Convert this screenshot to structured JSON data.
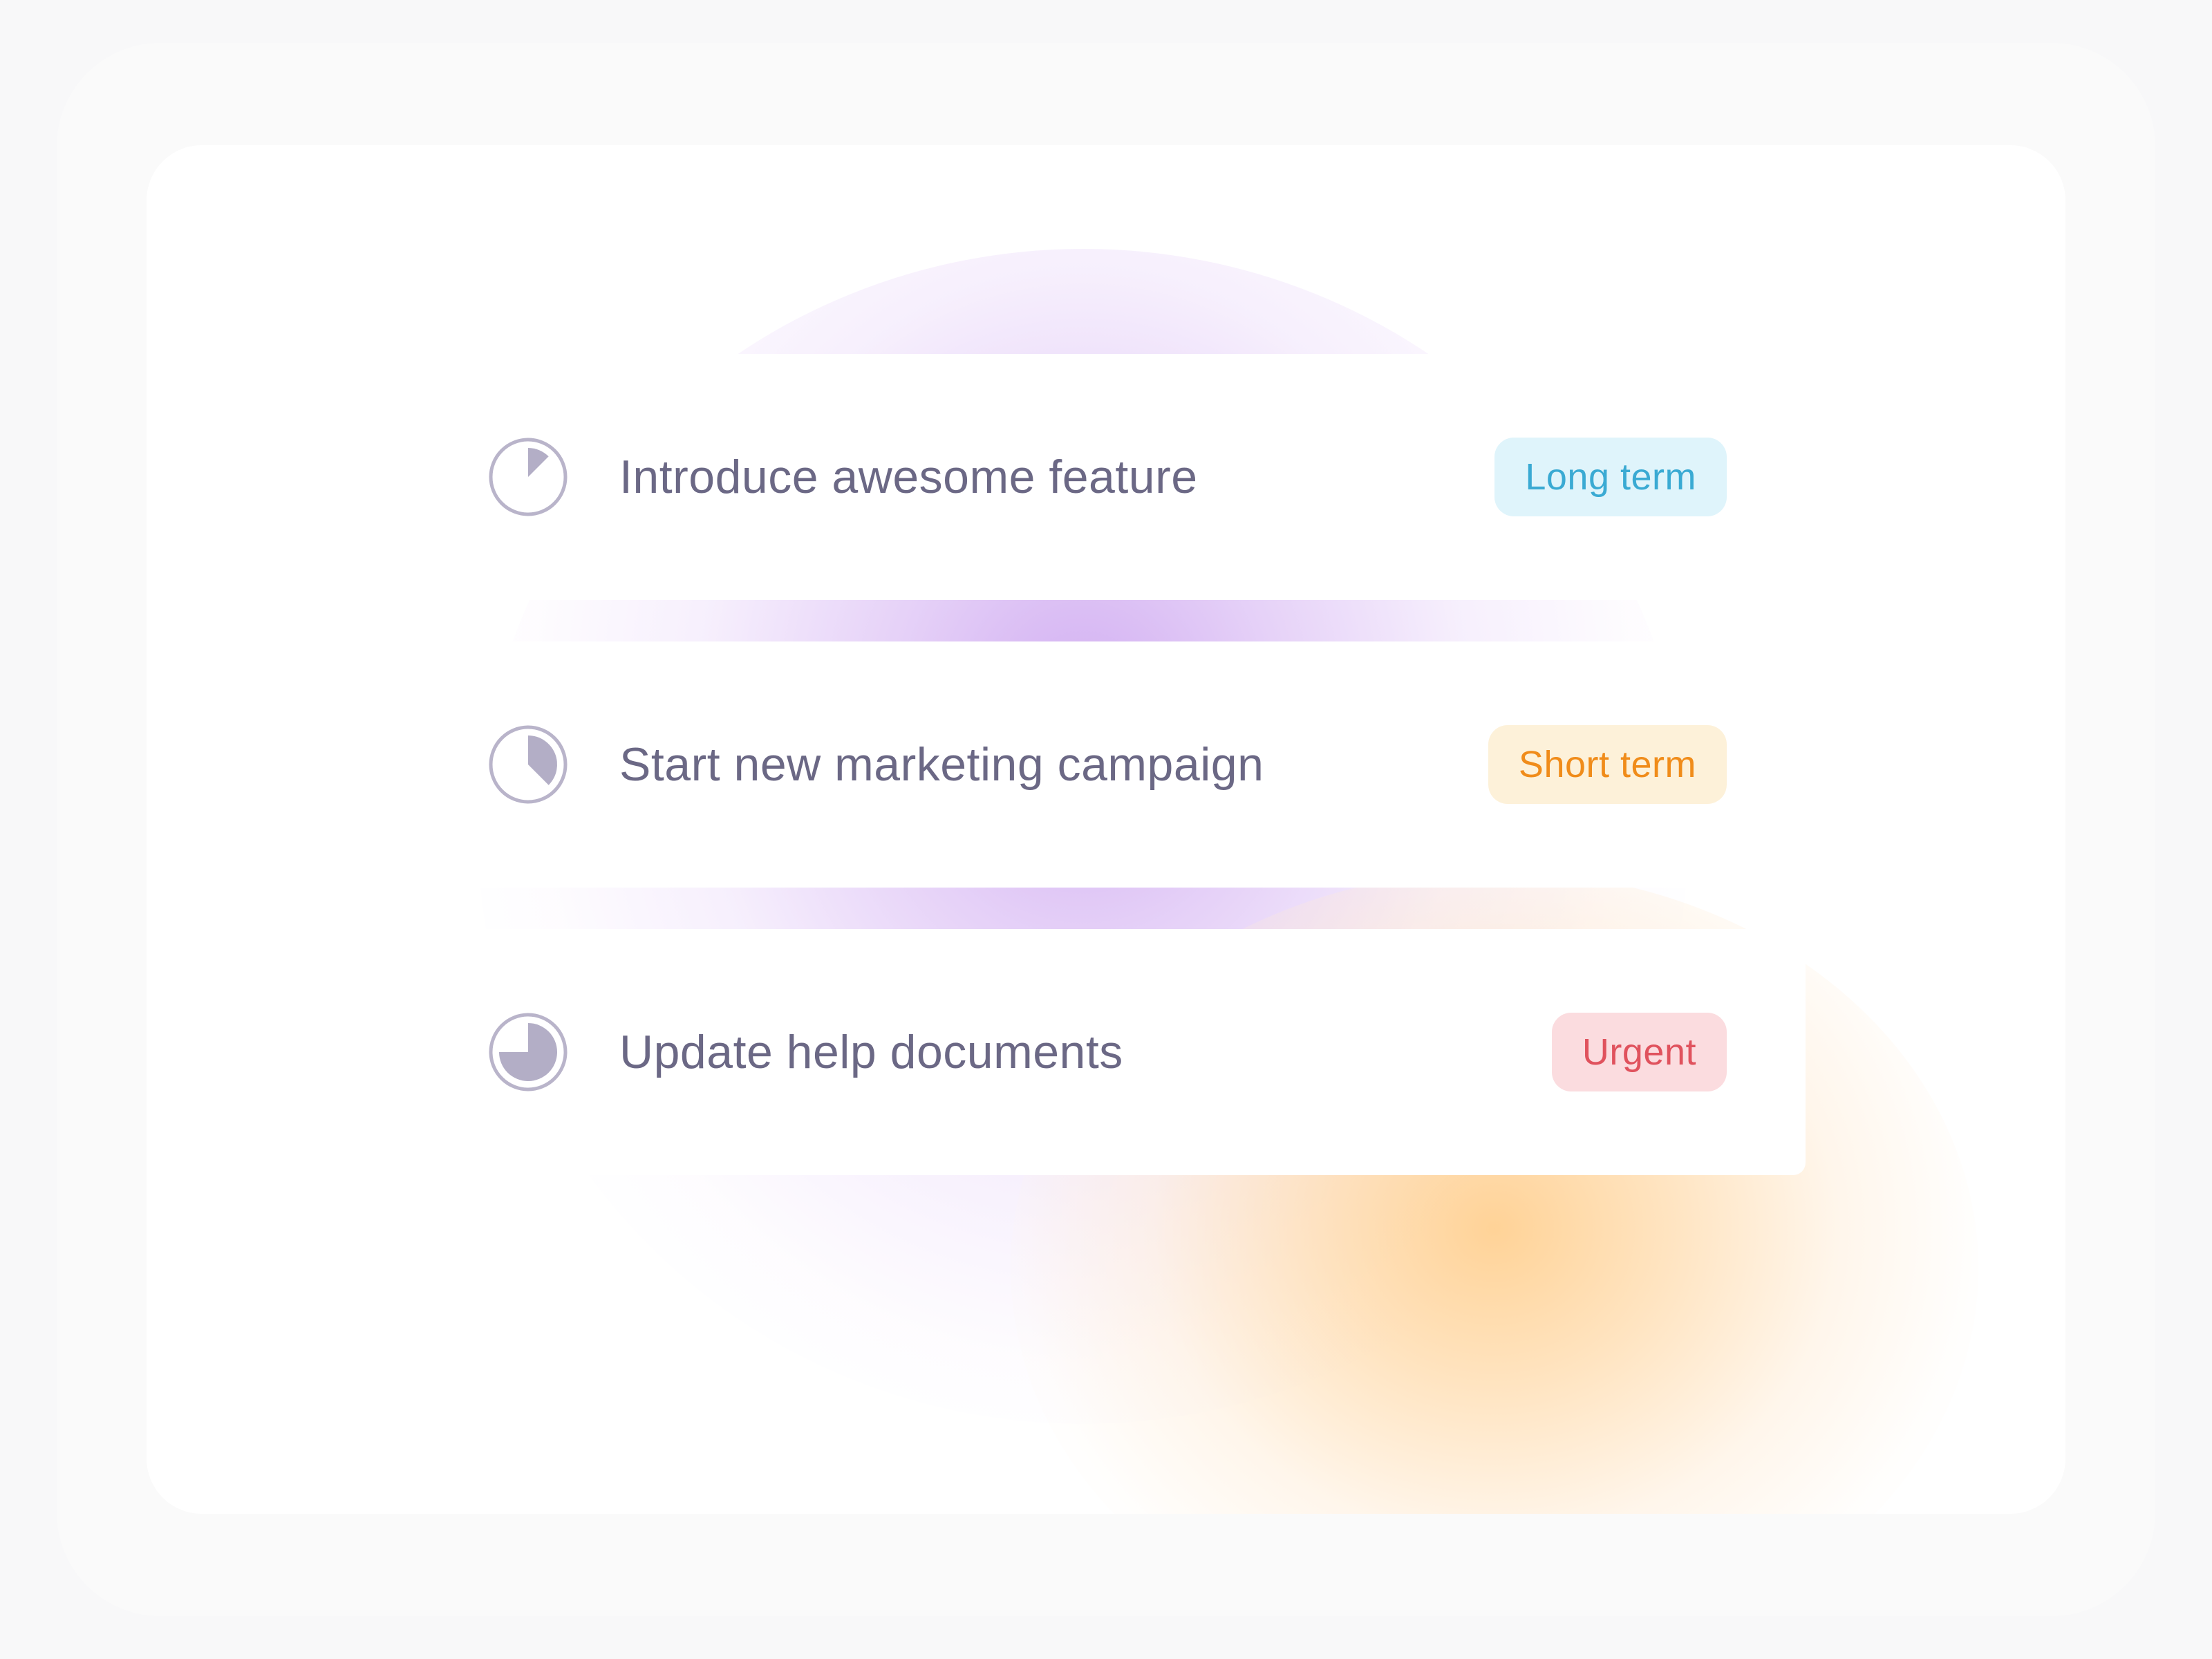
{
  "tasks": [
    {
      "title": "Introduce awesome feature",
      "tag": "Long term",
      "tag_color": "#3aaad3",
      "tag_bg": "#dff4fb",
      "progress": 0.125,
      "icon": "progress-pie-icon"
    },
    {
      "title": "Start new marketing campaign",
      "tag": "Short term",
      "tag_color": "#f08c1a",
      "tag_bg": "#fdf1d9",
      "progress": 0.375,
      "icon": "progress-pie-icon"
    },
    {
      "title": "Update help documents",
      "tag": "Urgent",
      "tag_color": "#e0525d",
      "tag_bg": "#fbdcdf",
      "progress": 0.75,
      "icon": "progress-pie-icon"
    }
  ],
  "colors": {
    "title_text": "#6b6885",
    "icon_ring": "#b9b4ca",
    "icon_fill": "#b3aec6",
    "glow_purple": "#cea8f0",
    "glow_orange": "#ffce8c"
  }
}
